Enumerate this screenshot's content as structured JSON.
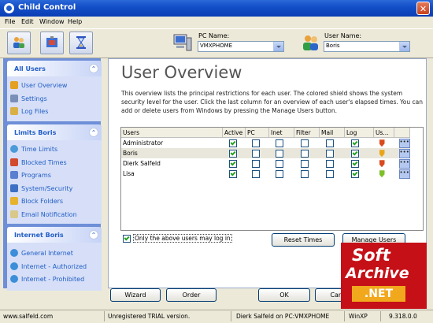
{
  "window": {
    "title": "Child Control",
    "close_glyph": "✕"
  },
  "menu": [
    "File",
    "Edit",
    "Window",
    "Help"
  ],
  "toolbar": {
    "pc_label": "PC Name:",
    "pc_value": "VMXPHOME",
    "user_label": "User Name:",
    "user_value": "Boris",
    "icons": [
      "users-icon",
      "device-settings-icon",
      "hourglass-icon",
      "pc-icon",
      "user-group-icon"
    ]
  },
  "sidebar": {
    "groups": [
      {
        "title": "All Users",
        "items": [
          {
            "label": "User Overview",
            "icon": "users-icon",
            "color": "#e4a020"
          },
          {
            "label": "Settings",
            "icon": "settings-icon",
            "color": "#7a8fb8"
          },
          {
            "label": "Log Files",
            "icon": "log-icon",
            "color": "#d9b046"
          }
        ]
      },
      {
        "title": "Limits Boris",
        "items": [
          {
            "label": "Time Limits",
            "icon": "clock-icon",
            "color": "#4c9ad8"
          },
          {
            "label": "Blocked Times",
            "icon": "blocked-times-icon",
            "color": "#d24a2e"
          },
          {
            "label": "Programs",
            "icon": "programs-icon",
            "color": "#5a7fd0"
          },
          {
            "label": "System/Security",
            "icon": "security-icon",
            "color": "#3d6fc4"
          },
          {
            "label": "Block Folders",
            "icon": "folder-icon",
            "color": "#e7b32e"
          },
          {
            "label": "Email Notification",
            "icon": "email-icon",
            "color": "#d8c88a"
          }
        ]
      },
      {
        "title": "Internet Boris",
        "items": [
          {
            "label": "General Internet",
            "icon": "globe-icon",
            "color": "#3c8ed8"
          },
          {
            "label": "Internet - Authorized",
            "icon": "globe-authorized-icon",
            "color": "#3c8ed8"
          },
          {
            "label": "Internet - Prohibited",
            "icon": "globe-prohibited-icon",
            "color": "#3c8ed8"
          }
        ]
      }
    ]
  },
  "main": {
    "title": "User Overview",
    "description": "This overview lists the principal restrictions for each user. The colored shield shows the system security level for the user. Click the last column for an overview of each user's elapsed times. You can add or delete users from Windows by pressing the Manage Users button.",
    "columns": [
      "Users",
      "Active",
      "PC",
      "Inet",
      "Filter",
      "Mail",
      "Log",
      "Us..."
    ],
    "rows": [
      {
        "name": "Administrator",
        "active": true,
        "pc": false,
        "inet": false,
        "filter": false,
        "mail": false,
        "log": true,
        "shield": "#d94b1e",
        "selected": false
      },
      {
        "name": "Boris",
        "active": true,
        "pc": false,
        "inet": false,
        "filter": false,
        "mail": false,
        "log": true,
        "shield": "#e8a51a",
        "selected": true
      },
      {
        "name": "Dierk Salfeld",
        "active": true,
        "pc": false,
        "inet": false,
        "filter": false,
        "mail": false,
        "log": true,
        "shield": "#d94b1e",
        "selected": false
      },
      {
        "name": "Lisa",
        "active": true,
        "pc": false,
        "inet": false,
        "filter": false,
        "mail": false,
        "log": true,
        "shield": "#7fbf2a",
        "selected": false
      }
    ],
    "more_glyph": "•••",
    "only_above_label": "Only the above users may log in",
    "only_above_checked": true,
    "reset_times": "Reset Times",
    "manage_users": "Manage Users"
  },
  "buttons": {
    "wizard": "Wizard",
    "order": "Order",
    "ok": "OK",
    "cancel": "Cancel"
  },
  "status": {
    "site": "www.salfeld.com",
    "trial": "Unregistered TRIAL version.",
    "user_pc": "Dierk Salfeld on PC:VMXPHOME",
    "os": "WinXP",
    "version": "9.318.0.0"
  },
  "watermark": {
    "line1": "Soft",
    "line2": "Archive",
    "line3": ".NET"
  }
}
